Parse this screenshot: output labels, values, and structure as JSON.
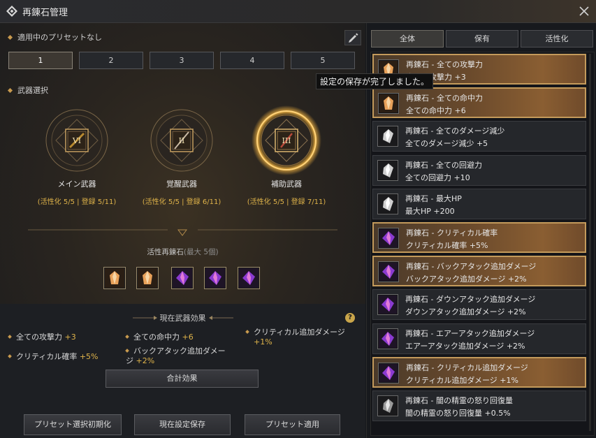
{
  "window": {
    "title": "再錬石管理"
  },
  "preset": {
    "status": "適用中のプリセットなし",
    "tabs": [
      "1",
      "2",
      "3",
      "4",
      "5"
    ],
    "active_tab": 0
  },
  "weapons": {
    "section_label": "武器選択",
    "items": [
      {
        "name": "メイン武器",
        "stat": "(活性化 5/5 | 登録 5/11)",
        "roman": "VI",
        "selected": false
      },
      {
        "name": "覚醒武器",
        "stat": "(活性化 5/5 | 登録 6/11)",
        "roman": "II",
        "selected": false
      },
      {
        "name": "補助武器",
        "stat": "(活性化 5/5 | 登録 7/11)",
        "roman": "III",
        "selected": true
      }
    ]
  },
  "active_stones": {
    "title": "活性再錬石",
    "max_note": "(最大 5個)",
    "stones": [
      "orange-crystal-icon",
      "orange-crystal-icon",
      "purple-crystal-icon",
      "purple-crystal-icon",
      "purple-crystal-icon"
    ]
  },
  "effects": {
    "title": "現在武器効果",
    "items": [
      {
        "label": "全ての攻撃力",
        "value": "+3"
      },
      {
        "label": "全ての命中力",
        "value": "+6"
      },
      {
        "label": "クリティカル追加ダメージ",
        "value": "+1%"
      },
      {
        "label": "クリティカル確率",
        "value": "+5%"
      },
      {
        "label": "バックアタック追加ダメー\nジ",
        "value": "+2%"
      }
    ],
    "total_button": "合計効果"
  },
  "footer": {
    "reset_button": "プリセット選択初期化",
    "save_button": "現在設定保存",
    "apply_button": "プリセット適用"
  },
  "filter_tabs": [
    "全体",
    "保有",
    "活性化"
  ],
  "stone_list": [
    {
      "name": "再錬石 - 全ての攻撃力",
      "effect": "全ての攻撃力 +3",
      "active": true,
      "icon": "orange-crystal-icon"
    },
    {
      "name": "再錬石 - 全ての命中力",
      "effect": "全ての命中力 +6",
      "active": true,
      "icon": "orange-crystal-icon"
    },
    {
      "name": "再錬石 - 全てのダメージ減少",
      "effect": "全てのダメージ減少 +5",
      "active": false,
      "icon": "white-crystal-icon"
    },
    {
      "name": "再錬石 - 全ての回避力",
      "effect": "全ての回避力 +10",
      "active": false,
      "icon": "white-crystal-icon"
    },
    {
      "name": "再錬石 - 最大HP",
      "effect": "最大HP +200",
      "active": false,
      "icon": "white-crystal-icon"
    },
    {
      "name": "再錬石 - クリティカル確率",
      "effect": "クリティカル確率 +5%",
      "active": true,
      "icon": "purple-crystal-icon"
    },
    {
      "name": "再錬石 - バックアタック追加ダメージ",
      "effect": "バックアタック追加ダメージ +2%",
      "active": true,
      "icon": "purple-crystal-icon"
    },
    {
      "name": "再錬石 - ダウンアタック追加ダメージ",
      "effect": "ダウンアタック追加ダメージ +2%",
      "active": false,
      "icon": "purple-crystal-icon"
    },
    {
      "name": "再錬石 - エアーアタック追加ダメージ",
      "effect": "エアーアタック追加ダメージ +2%",
      "active": false,
      "icon": "purple-crystal-icon"
    },
    {
      "name": "再錬石 - クリティカル追加ダメージ",
      "effect": "クリティカル追加ダメージ +1%",
      "active": true,
      "icon": "purple-crystal-icon"
    },
    {
      "name": "再錬石 - 闇の精霊の怒り回復量",
      "effect": "闇の精霊の怒り回復量 +0.5%",
      "active": false,
      "icon": "silver-crystal-icon"
    }
  ],
  "tooltip": "設定の保存が完了しました。",
  "colors": {
    "accent": "#e0b44a",
    "active_item": "#8a5e32",
    "panel": "#17191d"
  }
}
